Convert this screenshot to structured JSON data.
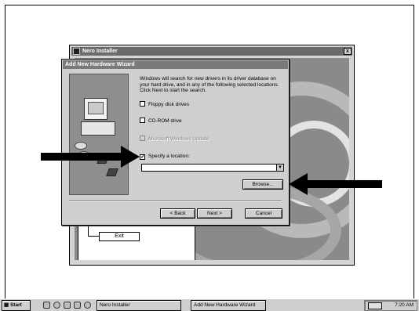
{
  "nero_window": {
    "title": "Nero Installer",
    "close_glyph": "x",
    "exit_label": "Exit"
  },
  "wizard": {
    "title": "Add New Hardware Wizard",
    "description": "Windows will search for new drivers in its driver database on your hard drive, and in any of the following selected locations. Click Next to start the search.",
    "options": [
      {
        "label": "Floppy disk drives",
        "checked": false,
        "enabled": true
      },
      {
        "label": "CD-ROM drive",
        "checked": false,
        "enabled": true
      },
      {
        "label": "Microsoft Windows Update",
        "checked": false,
        "enabled": false
      },
      {
        "label": "Specify a location:",
        "checked": true,
        "enabled": true
      }
    ],
    "location_value": "",
    "combo_arrow_glyph": "▼",
    "check_glyph": "✓",
    "browse_label": "Browse...",
    "back_label": "< Back",
    "next_label": "Next >",
    "cancel_label": "Cancel"
  },
  "taskbar": {
    "start_label": "Start",
    "tasks": [
      "Nero Installer",
      "Add New Hardware Wizard"
    ],
    "clock": "7:20 AM"
  },
  "colors": {
    "title_active": "#7a7a7a",
    "dialog_face": "#cfcfcf",
    "arrow": "#000000"
  },
  "icons": [
    "start-logo-icon",
    "computer-wizard-illustration",
    "tray-network-icon"
  ]
}
